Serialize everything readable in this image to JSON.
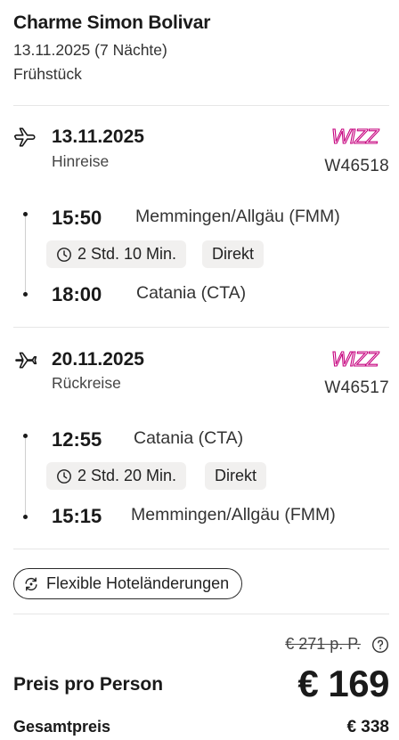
{
  "hotel": {
    "name": "Charme Simon Bolivar",
    "dates": "13.11.2025 (7 Nächte)",
    "board": "Frühstück"
  },
  "outbound": {
    "icon": "plane-departure-icon",
    "date": "13.11.2025",
    "kind": "Hinreise",
    "airline_logo_text": "WIZZ",
    "flight_number": "W46518",
    "depart_time": "15:50",
    "depart_airport": "Memmingen/Allgäu (FMM)",
    "duration": "2 Std. 10 Min.",
    "stops": "Direkt",
    "arrive_time": "18:00",
    "arrive_airport": "Catania (CTA)"
  },
  "return": {
    "icon": "plane-arrival-icon",
    "date": "20.11.2025",
    "kind": "Rückreise",
    "airline_logo_text": "WIZZ",
    "flight_number": "W46517",
    "depart_time": "12:55",
    "depart_airport": "Catania (CTA)",
    "duration": "2 Std. 20 Min.",
    "stops": "Direkt",
    "arrive_time": "15:15",
    "arrive_airport": "Memmingen/Allgäu (FMM)"
  },
  "flex_button": {
    "label": "Flexible Hoteländerungen"
  },
  "pricing": {
    "old_price": "€ 271 p. P.",
    "per_person_label": "Preis pro Person",
    "price": "€ 169",
    "total_label": "Gesamtpreis",
    "total_value": "€ 338"
  },
  "colors": {
    "wizz_logo": "#c6007e",
    "divider": "#e6e6e6",
    "chip_bg": "#f1f0ef"
  }
}
